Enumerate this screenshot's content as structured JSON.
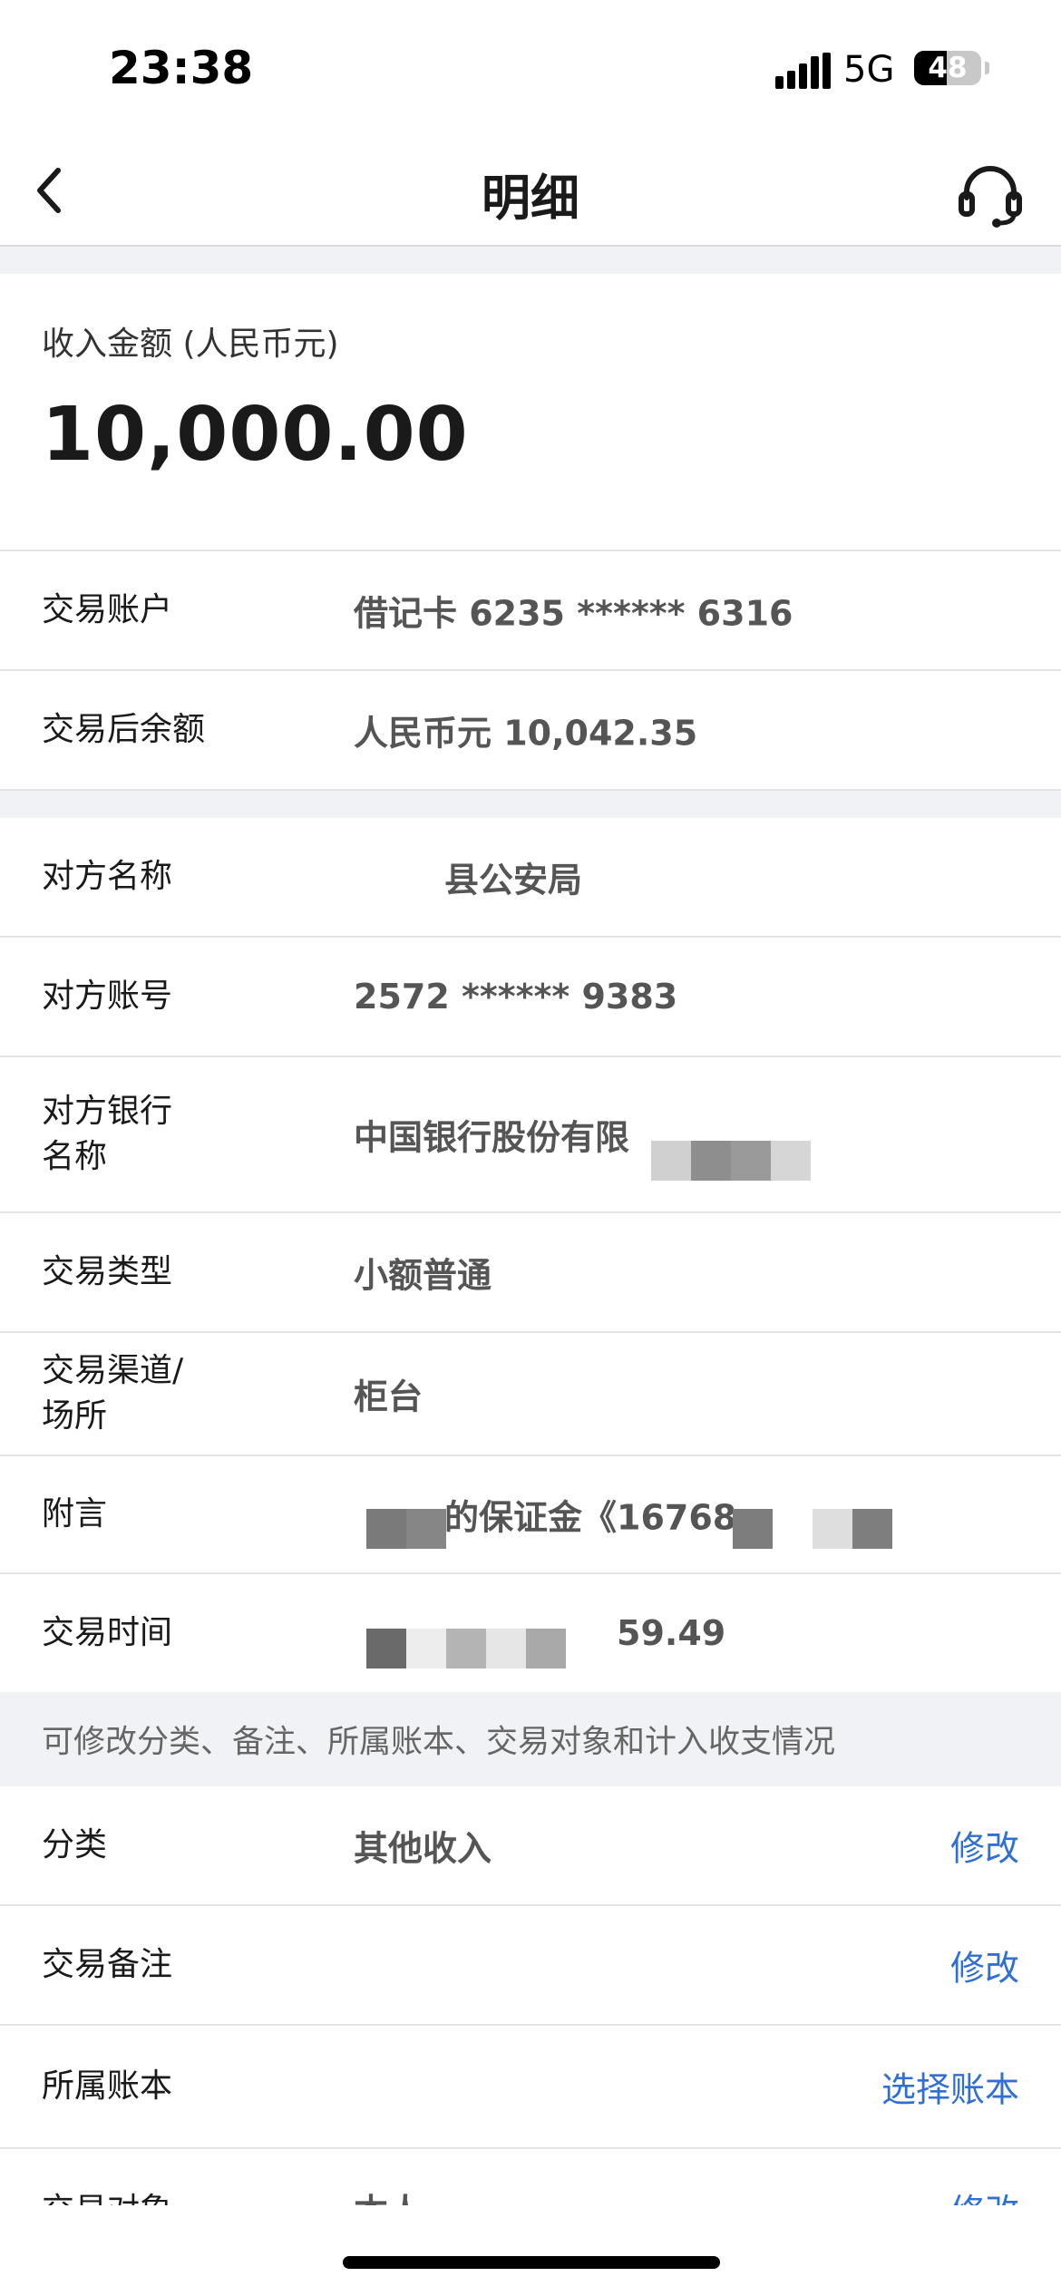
{
  "status_bar": {
    "time": "23:38",
    "network": "5G",
    "battery_percent": "48"
  },
  "nav": {
    "title": "明细",
    "back_icon": "chevron-left-icon",
    "service_icon": "headset-icon"
  },
  "summary": {
    "amount_label": "收入金额 (人民币元)",
    "amount": "10,000.00"
  },
  "account_rows": [
    {
      "label": "交易账户",
      "value": "借记卡 6235 ****** 6316"
    },
    {
      "label": "交易后余额",
      "value": "人民币元 10,042.35"
    }
  ],
  "detail_rows": [
    {
      "label": "对方名称",
      "value": "县公安局"
    },
    {
      "label": "对方账号",
      "value": "2572 ****** 9383"
    },
    {
      "label": "对方银行\n名称",
      "value": "中国银行股份有限"
    },
    {
      "label": "交易类型",
      "value": "小额普通"
    },
    {
      "label": "交易渠道/\n场所",
      "value": "柜台"
    },
    {
      "label": "附言",
      "value": "的保证金《16768"
    },
    {
      "label": "交易时间",
      "value": "59.49"
    }
  ],
  "hint": "可修改分类、备注、所属账本、交易对象和计入收支情况",
  "editable_rows": [
    {
      "label": "分类",
      "value": "其他收入",
      "action": "修改"
    },
    {
      "label": "交易备注",
      "value": "",
      "action": "修改"
    },
    {
      "label": "所属账本",
      "value": "",
      "action": "选择账本"
    },
    {
      "label": "交易对象",
      "value": "本人",
      "action": "修改"
    }
  ],
  "colors": {
    "link": "#2f6fd6",
    "band": "#f1f2f6",
    "divider": "#e3e3e3"
  }
}
